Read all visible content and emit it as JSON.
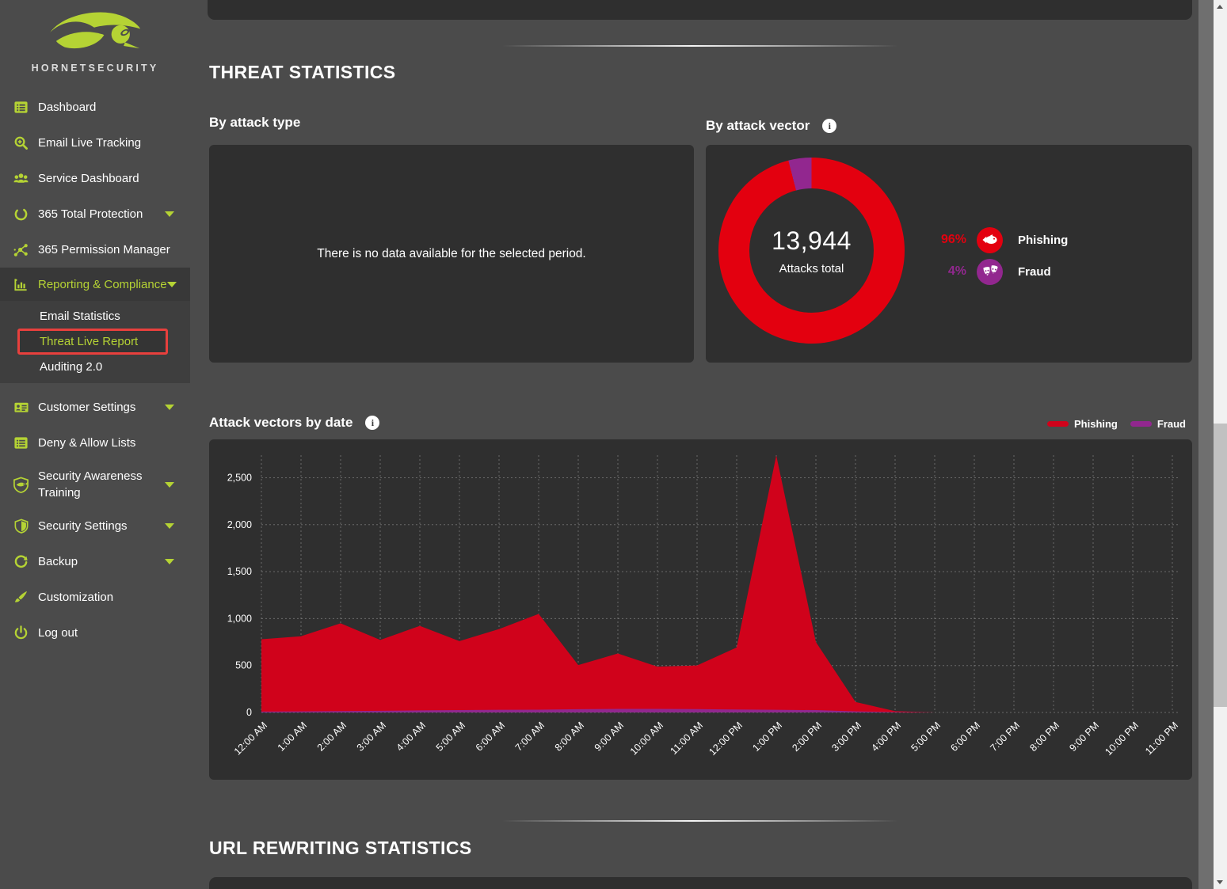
{
  "theme": {
    "main_bg": "#4b4b4b",
    "panel_bg": "#2f2f2f",
    "lime": "#b5d334",
    "section_bg": "#383838",
    "submenu_bg": "#3e3e3e",
    "selection_border": "#e8403d",
    "edge_strip": "#6f6f6f",
    "scrollbar_track": "#f1f1f1",
    "scrollbar_thumb": "#c1c1c1"
  },
  "brand": {
    "name": "HORNETSECURITY"
  },
  "sidebar": {
    "items": [
      {
        "label": "Dashboard",
        "icon": "dashboard-icon",
        "caret": false
      },
      {
        "label": "Email Live Tracking",
        "icon": "search-icon",
        "caret": false
      },
      {
        "label": "Service Dashboard",
        "icon": "team-icon",
        "caret": false
      },
      {
        "label": "365 Total Protection",
        "icon": "sync-icon",
        "caret": true
      },
      {
        "label": "365 Permission Manager",
        "icon": "network-icon",
        "caret": false
      },
      {
        "label": "Reporting & Compliance",
        "icon": "bar-chart-icon",
        "caret": true,
        "expanded": true
      },
      {
        "label": "Customer Settings",
        "icon": "id-card-icon",
        "caret": true
      },
      {
        "label": "Deny & Allow Lists",
        "icon": "list-icon",
        "caret": false
      },
      {
        "label": "Security Awareness Training",
        "icon": "shield-fish-icon",
        "caret": true
      },
      {
        "label": "Security Settings",
        "icon": "shield-icon",
        "caret": true
      },
      {
        "label": "Backup",
        "icon": "refresh-icon",
        "caret": true
      },
      {
        "label": "Customization",
        "icon": "brush-icon",
        "caret": false
      },
      {
        "label": "Log out",
        "icon": "power-icon",
        "caret": false
      }
    ],
    "submenu": [
      {
        "label": "Email Statistics",
        "selected": false
      },
      {
        "label": "Threat Live Report",
        "selected": true
      },
      {
        "label": "Auditing 2.0",
        "selected": false
      }
    ]
  },
  "headings": {
    "threat_statistics": "THREAT STATISTICS",
    "url_rewriting_statistics": "URL REWRITING STATISTICS"
  },
  "panels": {
    "by_attack_type": {
      "title": "By attack type",
      "empty_message": "There is no data available for the selected period."
    },
    "by_attack_vector": {
      "title": "By attack vector",
      "info_glyph": "i"
    },
    "attack_vectors_by_date": {
      "title": "Attack vectors by date",
      "info_glyph": "i"
    }
  },
  "chart_data": [
    {
      "type": "donut",
      "title": "By attack vector",
      "center_value": "13,944",
      "center_label": "Attacks total",
      "total": 13944,
      "slices": [
        {
          "name": "Phishing",
          "pct": 96,
          "pct_label": "96%",
          "color": "#e3000f",
          "icon": "fish-icon"
        },
        {
          "name": "Fraud",
          "pct": 4,
          "pct_label": "4%",
          "color": "#92278f",
          "icon": "masks-icon"
        }
      ]
    },
    {
      "type": "area",
      "stacked": true,
      "title": "Attack vectors by date",
      "legend_position": "top-right",
      "grid": "dashed",
      "ylim": [
        0,
        2800
      ],
      "yticks": [
        0,
        500,
        1000,
        1500,
        2000,
        2500
      ],
      "ytick_labels": [
        "0",
        "500",
        "1,000",
        "1,500",
        "2,000",
        "2,500"
      ],
      "x": [
        "12:00 AM",
        "1:00 AM",
        "2:00 AM",
        "3:00 AM",
        "4:00 AM",
        "5:00 AM",
        "6:00 AM",
        "7:00 AM",
        "8:00 AM",
        "9:00 AM",
        "10:00 AM",
        "11:00 AM",
        "12:00 PM",
        "1:00 PM",
        "2:00 PM",
        "3:00 PM",
        "4:00 PM",
        "5:00 PM",
        "6:00 PM",
        "7:00 PM",
        "8:00 PM",
        "9:00 PM",
        "10:00 PM",
        "11:00 PM"
      ],
      "series": [
        {
          "name": "Phishing",
          "color": "#d0021b",
          "values": [
            770,
            800,
            935,
            755,
            900,
            735,
            860,
            1020,
            470,
            590,
            450,
            465,
            660,
            2710,
            725,
            100,
            10,
            0,
            0,
            0,
            0,
            0,
            0,
            0
          ]
        },
        {
          "name": "Fraud",
          "color": "#92278f",
          "values": [
            10,
            12,
            15,
            18,
            22,
            25,
            28,
            30,
            35,
            38,
            38,
            36,
            32,
            28,
            25,
            12,
            4,
            0,
            0,
            0,
            0,
            0,
            0,
            0
          ]
        }
      ]
    }
  ]
}
